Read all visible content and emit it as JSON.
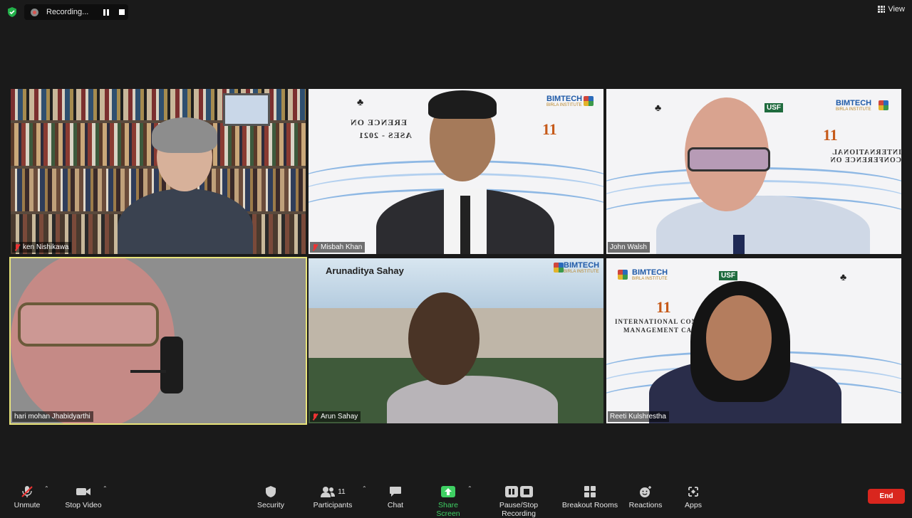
{
  "recording": {
    "status_text": "Recording..."
  },
  "view": {
    "label": "View"
  },
  "colors": {
    "accent_green": "#3fd063",
    "end_red": "#d9261e",
    "active_speaker": "#e9e47a",
    "mute_red": "#e33333"
  },
  "participants_tiles": [
    {
      "name": "ken Nishikawa",
      "muted": true
    },
    {
      "name": "Misbah Khan",
      "muted": true
    },
    {
      "name": "John Walsh",
      "muted": false
    },
    {
      "name": "hari mohan Jhabidyarthi",
      "muted": false,
      "active_speaker": true
    },
    {
      "name": "Arun Sahay",
      "muted": true
    },
    {
      "name": "Reeti Kulshrestha",
      "muted": false
    }
  ],
  "arun_banner": "Arunaditya Sahay",
  "toolbar": {
    "unmute": "Unmute",
    "stop_video": "Stop Video",
    "security": "Security",
    "participants": "Participants",
    "participants_count": "11",
    "chat": "Chat",
    "share_screen": "Share Screen",
    "pause_stop_recording": "Pause/Stop Recording",
    "breakout_rooms": "Breakout Rooms",
    "reactions": "Reactions",
    "apps": "Apps",
    "end": "End"
  }
}
